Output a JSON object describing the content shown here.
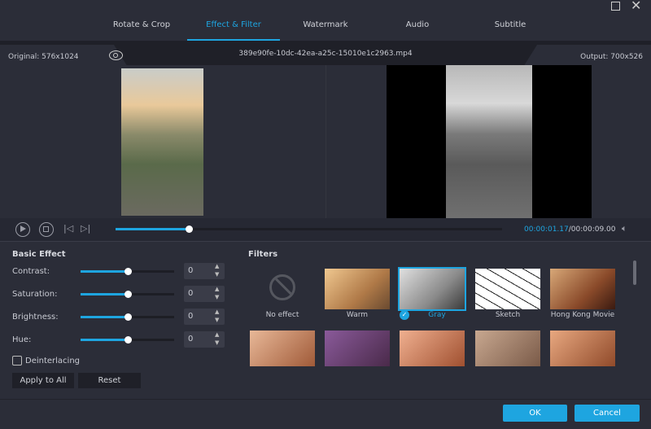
{
  "window": {
    "maximize_icon": "square-icon",
    "close_icon": "x-icon"
  },
  "tabs": [
    {
      "label": "Rotate & Crop"
    },
    {
      "label": "Effect & Filter",
      "active": true
    },
    {
      "label": "Watermark"
    },
    {
      "label": "Audio"
    },
    {
      "label": "Subtitle"
    }
  ],
  "info": {
    "original": "Original: 576x1024",
    "filename": "389e90fe-10dc-42ea-a25c-15010e1c2963.mp4",
    "output": "Output: 700x526"
  },
  "player": {
    "current_time": "00:00:01.17",
    "total_time": "/00:00:09.00",
    "progress_percent": 19
  },
  "basic_effect": {
    "title": "Basic Effect",
    "sliders": [
      {
        "label": "Contrast:",
        "value": "0",
        "level_percent": 50
      },
      {
        "label": "Saturation:",
        "value": "0",
        "level_percent": 50
      },
      {
        "label": "Brightness:",
        "value": "0",
        "level_percent": 50
      },
      {
        "label": "Hue:",
        "value": "0",
        "level_percent": 50
      }
    ],
    "deinterlacing": {
      "label": "Deinterlacing",
      "checked": false
    },
    "apply_all": "Apply to All",
    "reset": "Reset"
  },
  "filters": {
    "title": "Filters",
    "items": [
      {
        "label": "No effect"
      },
      {
        "label": "Warm"
      },
      {
        "label": "Gray",
        "selected": true
      },
      {
        "label": "Sketch"
      },
      {
        "label": "Hong Kong Movie"
      }
    ]
  },
  "footer": {
    "ok": "OK",
    "cancel": "Cancel"
  },
  "colors": {
    "accent": "#1ea5e0",
    "background": "#2b2d38"
  }
}
